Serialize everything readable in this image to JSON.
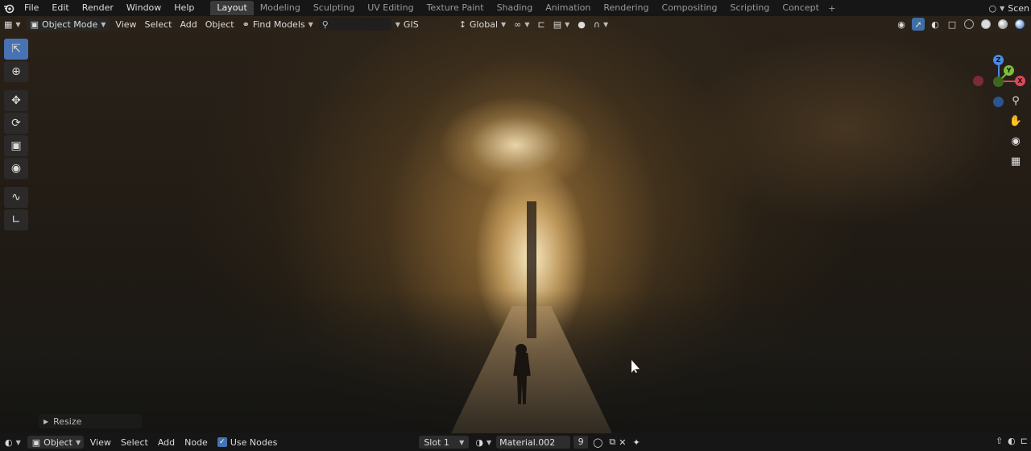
{
  "topbar": {
    "menus": [
      "File",
      "Edit",
      "Render",
      "Window",
      "Help"
    ],
    "workspaces": [
      "Layout",
      "Modeling",
      "Sculpting",
      "UV Editing",
      "Texture Paint",
      "Shading",
      "Animation",
      "Rendering",
      "Compositing",
      "Scripting",
      "Concept"
    ],
    "active_workspace": "Layout",
    "scene_label": "Scen"
  },
  "viewport_header": {
    "mode": "Object Mode",
    "menus": [
      "View",
      "Select",
      "Add",
      "Object"
    ],
    "find_models": "Find Models",
    "search_value": "",
    "gis": "GIS",
    "orientation": "Global"
  },
  "gizmo": {
    "z": "Z",
    "x": "X",
    "y": "Y"
  },
  "resize_panel": {
    "label": "Resize"
  },
  "node_header": {
    "editor_mode": "Object",
    "menus": [
      "View",
      "Select",
      "Add",
      "Node"
    ],
    "use_nodes_label": "Use Nodes",
    "use_nodes_checked": true,
    "slot": "Slot 1",
    "material": "Material.002",
    "user_count": "9"
  },
  "colors": {
    "accent": "#4772b3",
    "x_axis": "#e2465a",
    "y_axis": "#7cbf3a",
    "z_axis": "#4a8ae0"
  },
  "icons": {
    "logo": "blender-logo-icon",
    "tools": [
      "select-box-icon",
      "cursor-icon",
      "move-icon",
      "rotate-icon",
      "scale-icon",
      "transform-icon",
      "annotate-icon",
      "measure-icon"
    ],
    "nav": [
      "zoom-icon",
      "pan-hand-icon",
      "camera-icon",
      "grid-icon"
    ]
  }
}
